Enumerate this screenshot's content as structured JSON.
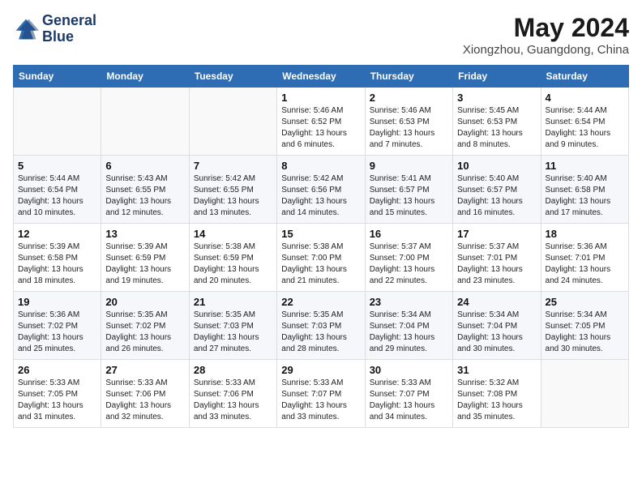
{
  "header": {
    "logo_line1": "General",
    "logo_line2": "Blue",
    "month_year": "May 2024",
    "location": "Xiongzhou, Guangdong, China"
  },
  "columns": [
    "Sunday",
    "Monday",
    "Tuesday",
    "Wednesday",
    "Thursday",
    "Friday",
    "Saturday"
  ],
  "weeks": [
    [
      {
        "day": "",
        "sunrise": "",
        "sunset": "",
        "daylight": ""
      },
      {
        "day": "",
        "sunrise": "",
        "sunset": "",
        "daylight": ""
      },
      {
        "day": "",
        "sunrise": "",
        "sunset": "",
        "daylight": ""
      },
      {
        "day": "1",
        "sunrise": "Sunrise: 5:46 AM",
        "sunset": "Sunset: 6:52 PM",
        "daylight": "Daylight: 13 hours and 6 minutes."
      },
      {
        "day": "2",
        "sunrise": "Sunrise: 5:46 AM",
        "sunset": "Sunset: 6:53 PM",
        "daylight": "Daylight: 13 hours and 7 minutes."
      },
      {
        "day": "3",
        "sunrise": "Sunrise: 5:45 AM",
        "sunset": "Sunset: 6:53 PM",
        "daylight": "Daylight: 13 hours and 8 minutes."
      },
      {
        "day": "4",
        "sunrise": "Sunrise: 5:44 AM",
        "sunset": "Sunset: 6:54 PM",
        "daylight": "Daylight: 13 hours and 9 minutes."
      }
    ],
    [
      {
        "day": "5",
        "sunrise": "Sunrise: 5:44 AM",
        "sunset": "Sunset: 6:54 PM",
        "daylight": "Daylight: 13 hours and 10 minutes."
      },
      {
        "day": "6",
        "sunrise": "Sunrise: 5:43 AM",
        "sunset": "Sunset: 6:55 PM",
        "daylight": "Daylight: 13 hours and 12 minutes."
      },
      {
        "day": "7",
        "sunrise": "Sunrise: 5:42 AM",
        "sunset": "Sunset: 6:55 PM",
        "daylight": "Daylight: 13 hours and 13 minutes."
      },
      {
        "day": "8",
        "sunrise": "Sunrise: 5:42 AM",
        "sunset": "Sunset: 6:56 PM",
        "daylight": "Daylight: 13 hours and 14 minutes."
      },
      {
        "day": "9",
        "sunrise": "Sunrise: 5:41 AM",
        "sunset": "Sunset: 6:57 PM",
        "daylight": "Daylight: 13 hours and 15 minutes."
      },
      {
        "day": "10",
        "sunrise": "Sunrise: 5:40 AM",
        "sunset": "Sunset: 6:57 PM",
        "daylight": "Daylight: 13 hours and 16 minutes."
      },
      {
        "day": "11",
        "sunrise": "Sunrise: 5:40 AM",
        "sunset": "Sunset: 6:58 PM",
        "daylight": "Daylight: 13 hours and 17 minutes."
      }
    ],
    [
      {
        "day": "12",
        "sunrise": "Sunrise: 5:39 AM",
        "sunset": "Sunset: 6:58 PM",
        "daylight": "Daylight: 13 hours and 18 minutes."
      },
      {
        "day": "13",
        "sunrise": "Sunrise: 5:39 AM",
        "sunset": "Sunset: 6:59 PM",
        "daylight": "Daylight: 13 hours and 19 minutes."
      },
      {
        "day": "14",
        "sunrise": "Sunrise: 5:38 AM",
        "sunset": "Sunset: 6:59 PM",
        "daylight": "Daylight: 13 hours and 20 minutes."
      },
      {
        "day": "15",
        "sunrise": "Sunrise: 5:38 AM",
        "sunset": "Sunset: 7:00 PM",
        "daylight": "Daylight: 13 hours and 21 minutes."
      },
      {
        "day": "16",
        "sunrise": "Sunrise: 5:37 AM",
        "sunset": "Sunset: 7:00 PM",
        "daylight": "Daylight: 13 hours and 22 minutes."
      },
      {
        "day": "17",
        "sunrise": "Sunrise: 5:37 AM",
        "sunset": "Sunset: 7:01 PM",
        "daylight": "Daylight: 13 hours and 23 minutes."
      },
      {
        "day": "18",
        "sunrise": "Sunrise: 5:36 AM",
        "sunset": "Sunset: 7:01 PM",
        "daylight": "Daylight: 13 hours and 24 minutes."
      }
    ],
    [
      {
        "day": "19",
        "sunrise": "Sunrise: 5:36 AM",
        "sunset": "Sunset: 7:02 PM",
        "daylight": "Daylight: 13 hours and 25 minutes."
      },
      {
        "day": "20",
        "sunrise": "Sunrise: 5:35 AM",
        "sunset": "Sunset: 7:02 PM",
        "daylight": "Daylight: 13 hours and 26 minutes."
      },
      {
        "day": "21",
        "sunrise": "Sunrise: 5:35 AM",
        "sunset": "Sunset: 7:03 PM",
        "daylight": "Daylight: 13 hours and 27 minutes."
      },
      {
        "day": "22",
        "sunrise": "Sunrise: 5:35 AM",
        "sunset": "Sunset: 7:03 PM",
        "daylight": "Daylight: 13 hours and 28 minutes."
      },
      {
        "day": "23",
        "sunrise": "Sunrise: 5:34 AM",
        "sunset": "Sunset: 7:04 PM",
        "daylight": "Daylight: 13 hours and 29 minutes."
      },
      {
        "day": "24",
        "sunrise": "Sunrise: 5:34 AM",
        "sunset": "Sunset: 7:04 PM",
        "daylight": "Daylight: 13 hours and 30 minutes."
      },
      {
        "day": "25",
        "sunrise": "Sunrise: 5:34 AM",
        "sunset": "Sunset: 7:05 PM",
        "daylight": "Daylight: 13 hours and 30 minutes."
      }
    ],
    [
      {
        "day": "26",
        "sunrise": "Sunrise: 5:33 AM",
        "sunset": "Sunset: 7:05 PM",
        "daylight": "Daylight: 13 hours and 31 minutes."
      },
      {
        "day": "27",
        "sunrise": "Sunrise: 5:33 AM",
        "sunset": "Sunset: 7:06 PM",
        "daylight": "Daylight: 13 hours and 32 minutes."
      },
      {
        "day": "28",
        "sunrise": "Sunrise: 5:33 AM",
        "sunset": "Sunset: 7:06 PM",
        "daylight": "Daylight: 13 hours and 33 minutes."
      },
      {
        "day": "29",
        "sunrise": "Sunrise: 5:33 AM",
        "sunset": "Sunset: 7:07 PM",
        "daylight": "Daylight: 13 hours and 33 minutes."
      },
      {
        "day": "30",
        "sunrise": "Sunrise: 5:33 AM",
        "sunset": "Sunset: 7:07 PM",
        "daylight": "Daylight: 13 hours and 34 minutes."
      },
      {
        "day": "31",
        "sunrise": "Sunrise: 5:32 AM",
        "sunset": "Sunset: 7:08 PM",
        "daylight": "Daylight: 13 hours and 35 minutes."
      },
      {
        "day": "",
        "sunrise": "",
        "sunset": "",
        "daylight": ""
      }
    ]
  ]
}
